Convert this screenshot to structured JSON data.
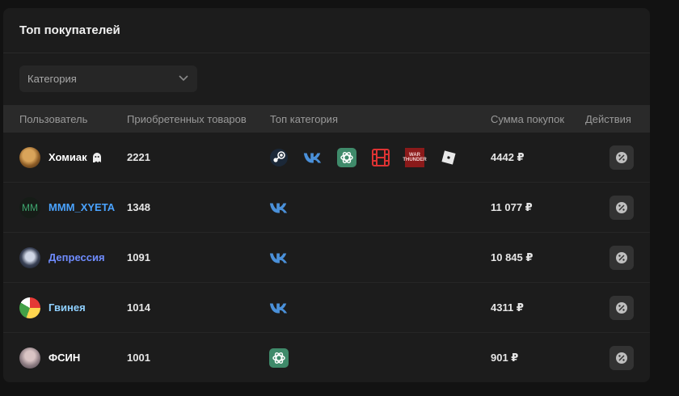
{
  "title": "Топ покупателей",
  "filter": {
    "placeholder": "Категория"
  },
  "columns": {
    "user": "Пользователь",
    "count": "Приобретенных товаров",
    "category": "Топ категория",
    "sum": "Сумма покупок",
    "actions": "Действия"
  },
  "rows": [
    {
      "name": "Хомиак",
      "count": "2221",
      "sum": "4442 ₽",
      "name_color": "#ffffff",
      "avatar_text": "",
      "categories": [
        "steam-icon",
        "vk-icon",
        "chatgpt-icon",
        "film-icon",
        "war-thunder-icon",
        "roblox-icon"
      ]
    },
    {
      "name": "MMM_XYETA",
      "count": "1348",
      "sum": "11 077 ₽",
      "name_color": "#4aa3ff",
      "avatar_text": "MM",
      "categories": [
        "vk-icon"
      ]
    },
    {
      "name": "Депрессия",
      "count": "1091",
      "sum": "10 845 ₽",
      "name_color": "#6f8cff",
      "avatar_text": "",
      "categories": [
        "vk-icon"
      ]
    },
    {
      "name": "Гвинея",
      "count": "1014",
      "sum": "4311 ₽",
      "name_color": "#8fd0ff",
      "avatar_text": "",
      "categories": [
        "vk-icon"
      ]
    },
    {
      "name": "ФСИН",
      "count": "1001",
      "sum": "901 ₽",
      "name_color": "#ffffff",
      "avatar_text": "",
      "categories": [
        "chatgpt-icon"
      ]
    }
  ],
  "war_thunder_label": "WAR THUNDER",
  "colors": {
    "accent": "#4aa3ff",
    "vk": "#4a90d9",
    "chatgpt": "#3f8a6a",
    "film": "#d33",
    "war_thunder": "#8b1a1a"
  }
}
